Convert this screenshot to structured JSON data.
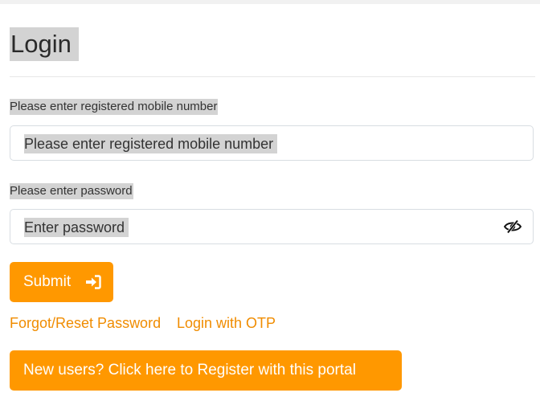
{
  "page": {
    "title": "Login"
  },
  "form": {
    "mobile_label": "Please enter registered mobile number",
    "mobile_placeholder": "Please enter registered mobile number",
    "password_label": "Please enter password",
    "password_placeholder": "Enter password",
    "password_toggle_icon": "eye-slash-icon",
    "submit_label": "Submit",
    "submit_icon": "sign-in-icon"
  },
  "links": {
    "forgot_password": "Forgot/Reset Password",
    "login_otp": "Login with OTP"
  },
  "register": {
    "label": "New users? Click here to Register with this portal"
  },
  "colors": {
    "accent": "#ff9800",
    "link": "#f08c00",
    "highlight": "#d3d3d3"
  }
}
